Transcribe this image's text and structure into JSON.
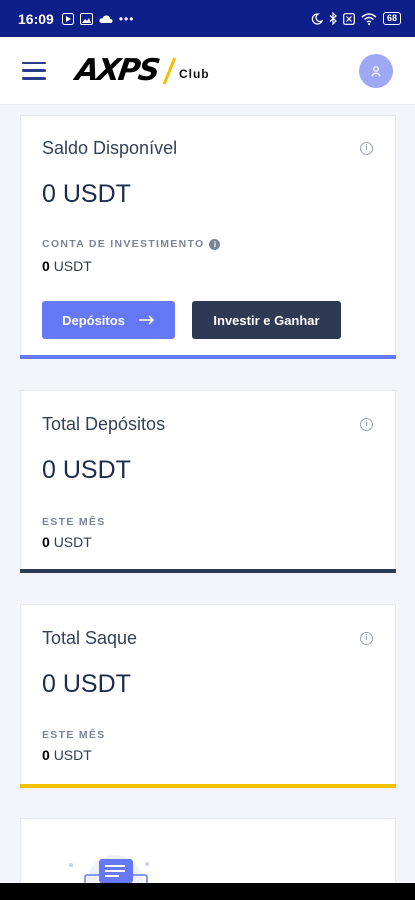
{
  "status_bar": {
    "time": "16:09",
    "battery": "68"
  },
  "header": {
    "logo_text": "AXPS",
    "logo_sub": "Club"
  },
  "cards": {
    "balance": {
      "title": "Saldo Disponível",
      "amount": "0 USDT",
      "sub_label": "CONTA DE INVESTIMENTO",
      "sub_value_num": "0",
      "sub_value_unit": "USDT",
      "deposit_button": "Depósitos",
      "invest_button": "Investir e Ganhar",
      "accent_color": "#6578f5"
    },
    "deposits": {
      "title": "Total Depósitos",
      "amount": "0 USDT",
      "sub_label": "ESTE MÊS",
      "sub_value_num": "0",
      "sub_value_unit": "USDT",
      "accent_color": "#2e3a53"
    },
    "withdrawals": {
      "title": "Total Saque",
      "amount": "0 USDT",
      "sub_label": "ESTE MÊS",
      "sub_value_num": "0",
      "sub_value_unit": "USDT",
      "accent_color": "#f2c200"
    }
  },
  "icons": {
    "status_left": [
      "play-icon",
      "image-icon",
      "cloud-icon",
      "more-icon"
    ],
    "status_right": [
      "moon-icon",
      "bluetooth-icon",
      "no-sim-icon",
      "wifi-icon",
      "battery-icon"
    ]
  }
}
